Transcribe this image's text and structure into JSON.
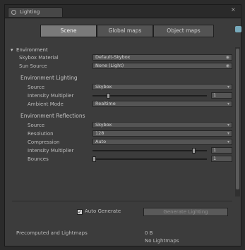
{
  "window": {
    "title": "Lighting",
    "close_glyph": "×",
    "menu_glyph": "≡"
  },
  "tabs": [
    "Scene",
    "Global maps",
    "Object maps"
  ],
  "environment": {
    "header": "Environment",
    "skybox_label": "Skybox Material",
    "skybox_value": "Default-Skybox",
    "sun_label": "Sun Source",
    "sun_value": "None (Light)",
    "lighting": {
      "header": "Environment Lighting",
      "source_label": "Source",
      "source_value": "Skybox",
      "intensity_label": "Intensity Multiplier",
      "intensity_value": "1",
      "intensity_fraction": 0.125,
      "ambient_label": "Ambient Mode",
      "ambient_value": "Realtime"
    },
    "reflections": {
      "header": "Environment Reflections",
      "source_label": "Source",
      "source_value": "Skybox",
      "resolution_label": "Resolution",
      "resolution_value": "128",
      "compression_label": "Compression",
      "compression_value": "Auto",
      "intensity_label": "Intensity Multiplier",
      "intensity_value": "1",
      "intensity_fraction": 0.9,
      "bounces_label": "Bounces",
      "bounces_value": "1",
      "bounces_fraction": 0.0
    }
  },
  "footer": {
    "auto_generate_label": "Auto Generate",
    "auto_generate_checked": true,
    "generate_button": "Generate Lighting",
    "stats_label": "Precomputed and Lightmaps",
    "stats_line1": "0 B",
    "stats_line2": "No Lightmaps"
  }
}
